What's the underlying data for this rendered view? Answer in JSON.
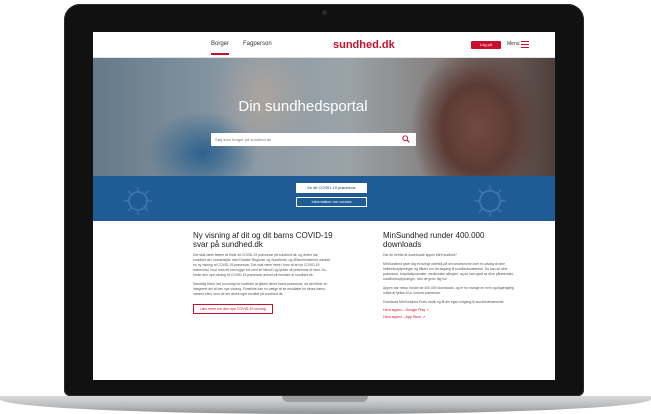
{
  "header": {
    "tabs": [
      "Borger",
      "Fagperson"
    ],
    "active_tab": "Borger",
    "logo": "sundhed.dk",
    "login_label": "Log på",
    "menu_label": "Menu"
  },
  "hero": {
    "title": "Din sundhedsportal",
    "search_placeholder": "Søg som borger på sundhed.dk"
  },
  "band": {
    "primary_button": "Se dit COVID-19 prøvesvar",
    "secondary_button": "Information om corona"
  },
  "left_article": {
    "title": "Ny visning af dit og dit barns COVID-19 svar på sundhed.dk",
    "paragraphs": [
      "Det skal være lettere at finde sit COVID-19 prøvesvar på sundhed.dk, og derfor har sundhed.dk i samarbejde med Danske Regioner og Sundheds- og Ældreministeriet udviklet en ny visning af COVID-19-prøvesvar. Det skal være nemt i form af at nyt COVID-19 svarmodul, hvor man let kan logge ind med sit NemID og tjekke sit prøvesvar ét sted. Du finder den nye visning af COVID-19 prøvesvar øverst på forsiden af sundhed.dk.",
      "Samtidig bliver det nu muligt for forældre at tjekke deres barns prøvesvar, da det bliver en integreret del af den nye visning. Forældre kan nu vælge at se resultatet for deres barns samme sted, som de ser deres eget resultat på sundhed.dk."
    ],
    "button": "Læs mere om den nye COVID-19 visning"
  },
  "right_article": {
    "title": "MinSundhed runder 400.000 downloads",
    "paragraphs": [
      "Har du hentet at downloade appen MinSundhed?",
      "MinSundhed giver dig et hurtigt overblik på din smartphone over et udvalg af dine helbredsoplysninger og tiltider om ret adgang til sundhedsvæsenet. Du kan se dine prøvesvar, hospitalsjournaler, medicinske allergier, og du kan også se dine pårørendes sundhedsoplysninger, hvis de giver dig lov.",
      "Appen har netop rundet de 400.000 downloads, og er for mange en nem og tilgængelig måde at tjekke bl.a. corona-prøvesvar.",
      "Download MinSundhed til din mobil og få din egen indgang til sundhedsvæsenet."
    ],
    "links": [
      "Hent appen – Google Play ↗",
      "Hent appen – App Store ↗"
    ]
  },
  "colors": {
    "brand_red": "#c8102e",
    "band_blue": "#1f5b95"
  }
}
